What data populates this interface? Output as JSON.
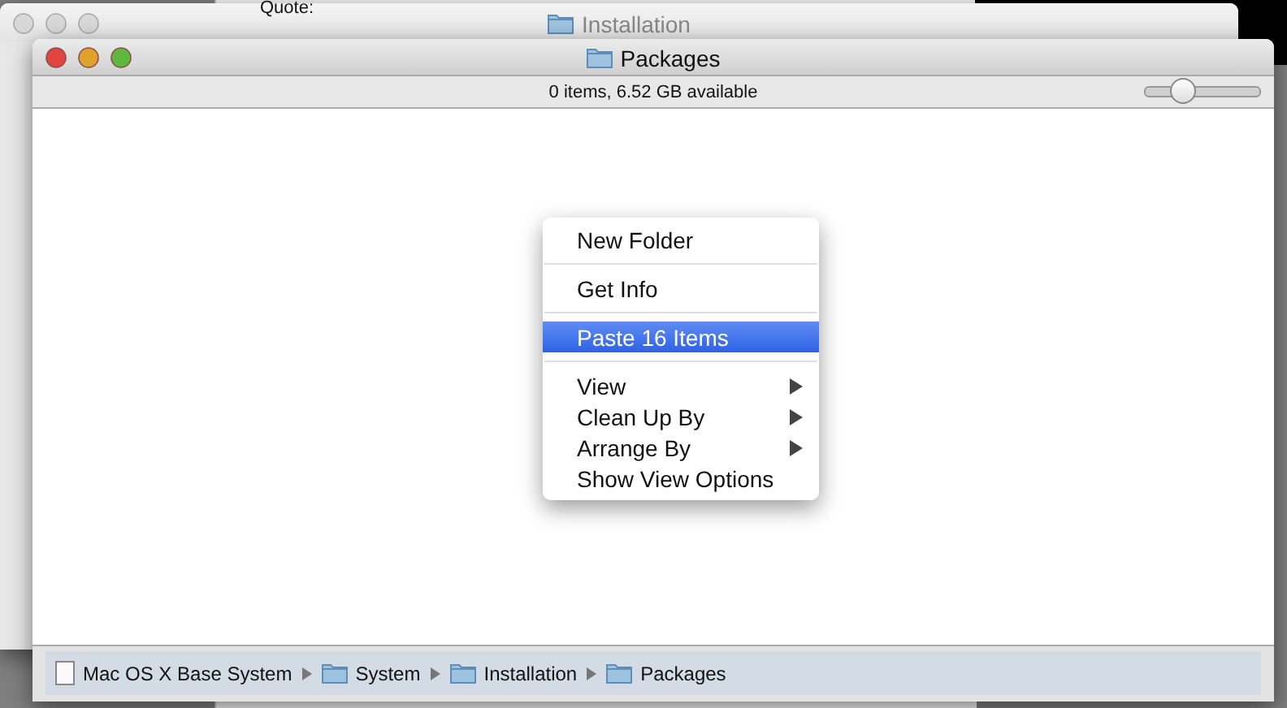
{
  "background_page": {
    "text": "Quote:"
  },
  "back_window": {
    "title": "Installation"
  },
  "window": {
    "title": "Packages",
    "status_text": "0 items, 6.52 GB available",
    "icon_size_slider": {
      "level": 0.27
    },
    "path_bar": [
      {
        "label": "Mac OS X Base System",
        "kind": "disk"
      },
      {
        "label": "System",
        "kind": "folder"
      },
      {
        "label": "Installation",
        "kind": "folder"
      },
      {
        "label": "Packages",
        "kind": "folder"
      }
    ]
  },
  "context_menu": [
    {
      "kind": "item",
      "label": "New Folder",
      "selected": false,
      "submenu": false
    },
    {
      "kind": "separator"
    },
    {
      "kind": "item",
      "label": "Get Info",
      "selected": false,
      "submenu": false
    },
    {
      "kind": "separator"
    },
    {
      "kind": "item",
      "label": "Paste 16 Items",
      "selected": true,
      "submenu": false
    },
    {
      "kind": "separator"
    },
    {
      "kind": "item",
      "label": "View",
      "selected": false,
      "submenu": true
    },
    {
      "kind": "item",
      "label": "Clean Up By",
      "selected": false,
      "submenu": true
    },
    {
      "kind": "item",
      "label": "Arrange By",
      "selected": false,
      "submenu": true
    },
    {
      "kind": "item",
      "label": "Show View Options",
      "selected": false,
      "submenu": false
    }
  ]
}
